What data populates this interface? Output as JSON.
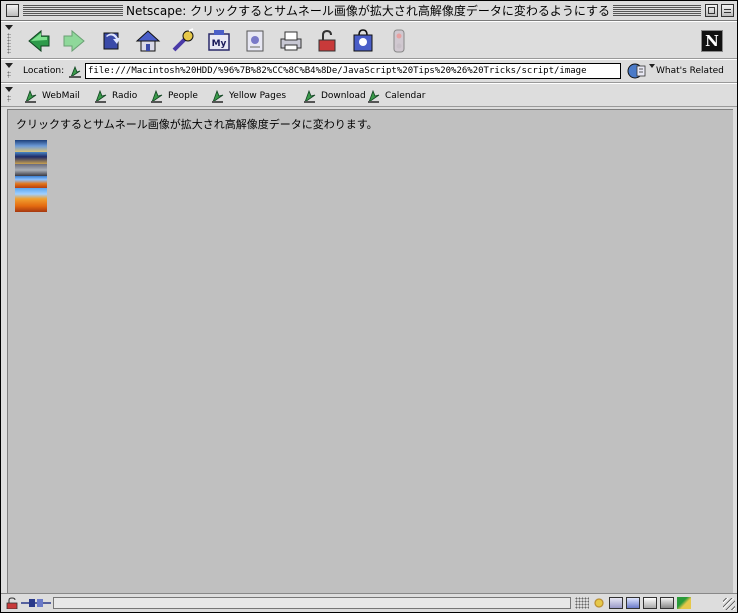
{
  "window": {
    "title": "Netscape: クリックするとサムネール画像が拡大され高解像度データに変わるようにする"
  },
  "nav_toolbar": {
    "buttons": [
      {
        "name": "back-button",
        "icon": "back-arrow-icon"
      },
      {
        "name": "forward-button",
        "icon": "forward-arrow-icon"
      },
      {
        "name": "reload-button",
        "icon": "reload-icon"
      },
      {
        "name": "home-button",
        "icon": "home-icon"
      },
      {
        "name": "search-button",
        "icon": "search-icon"
      },
      {
        "name": "my-netscape-button",
        "icon": "my-netscape-icon"
      },
      {
        "name": "images-button",
        "icon": "images-icon"
      },
      {
        "name": "print-button",
        "icon": "print-icon"
      },
      {
        "name": "security-button",
        "icon": "lock-icon"
      },
      {
        "name": "shop-button",
        "icon": "shop-icon"
      },
      {
        "name": "stop-button",
        "icon": "stop-icon"
      }
    ],
    "logo": "N"
  },
  "location_bar": {
    "label": "Location:",
    "url": "file:///Macintosh%20HDD/%96%7B%82%CC%8C%B4%8De/JavaScript%20Tips%20%26%20Tricks/script/image",
    "related_label": "What's Related"
  },
  "personal_toolbar": {
    "items": [
      {
        "label": "WebMail"
      },
      {
        "label": "Radio"
      },
      {
        "label": "People"
      },
      {
        "label": "Yellow Pages"
      },
      {
        "label": "Download"
      },
      {
        "label": "Calendar"
      }
    ]
  },
  "content": {
    "heading": "クリックするとサムネール画像が拡大され高解像度データに変わります。",
    "background_color": "#c0c0c0"
  }
}
